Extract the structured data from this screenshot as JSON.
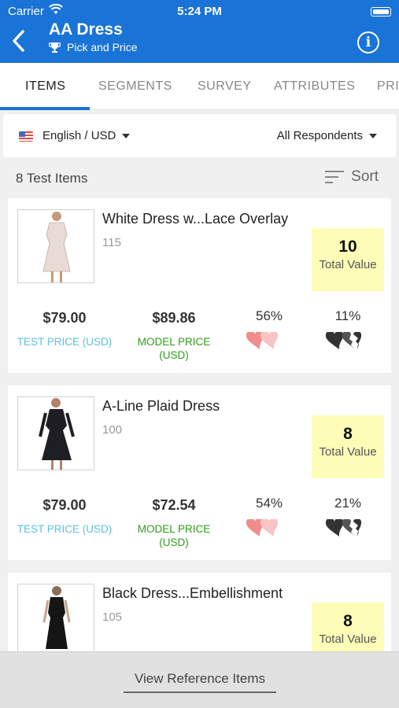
{
  "status": {
    "carrier": "Carrier",
    "time": "5:24 PM"
  },
  "header": {
    "title": "AA Dress",
    "subtitle": "Pick and Price",
    "subtitle_icon": "trophy-icon",
    "info_icon": "info-icon"
  },
  "tabs": [
    {
      "label": "ITEMS",
      "active": true
    },
    {
      "label": "SEGMENTS",
      "active": false
    },
    {
      "label": "SURVEY",
      "active": false
    },
    {
      "label": "ATTRIBUTES",
      "active": false
    },
    {
      "label": "PRI",
      "active": false
    }
  ],
  "filters": {
    "language": "English / USD",
    "respondents": "All Respondents"
  },
  "list": {
    "count_label": "8 Test Items",
    "sort_label": "Sort"
  },
  "items": [
    {
      "name": "White Dress w...Lace Overlay",
      "id": "115",
      "total_value": "10",
      "total_value_label": "Total Value",
      "test_price": "$79.00",
      "test_price_label": "TEST PRICE (USD)",
      "model_price": "$89.86",
      "model_price_label": "MODEL PRICE (USD)",
      "like_pct": "56%",
      "dislike_pct": "11%",
      "dress_color": "#e8dbd6"
    },
    {
      "name": "A-Line Plaid Dress",
      "id": "100",
      "total_value": "8",
      "total_value_label": "Total Value",
      "test_price": "$79.00",
      "test_price_label": "TEST PRICE (USD)",
      "model_price": "$72.54",
      "model_price_label": "MODEL PRICE (USD)",
      "like_pct": "54%",
      "dislike_pct": "21%",
      "dress_color": "#1e1e24"
    },
    {
      "name": "Black Dress...Embellishment",
      "id": "105",
      "total_value": "8",
      "total_value_label": "Total Value",
      "test_price": "",
      "test_price_label": "",
      "model_price": "",
      "model_price_label": "",
      "like_pct": "",
      "dislike_pct": "",
      "dress_color": "#151515"
    }
  ],
  "footer": {
    "reference_button": "View Reference Items"
  },
  "colors": {
    "brand": "#1a73d6",
    "test_price": "#5bc0de",
    "model_price": "#2e9e1a",
    "total_value_bg": "#fdfdb8",
    "heart_pink": "#f28b8b"
  }
}
